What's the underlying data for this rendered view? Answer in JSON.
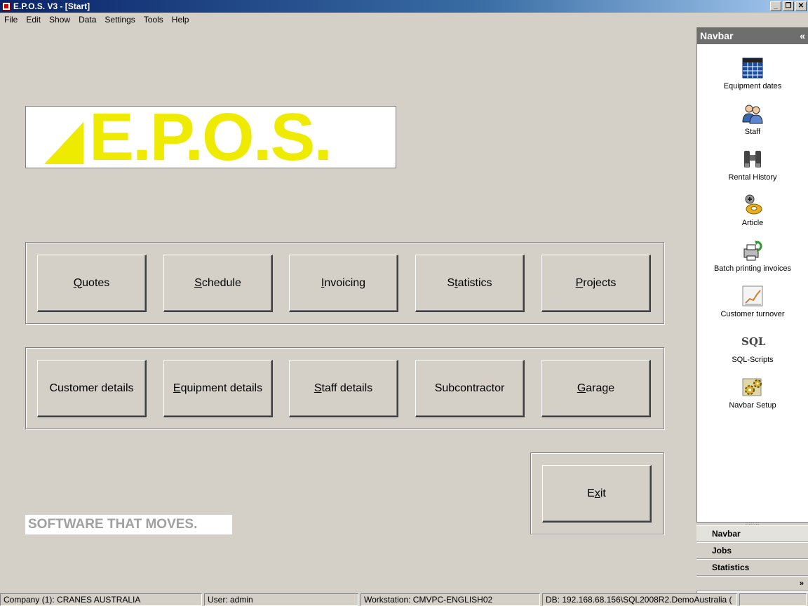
{
  "window": {
    "title": "E.P.O.S. V3 - [Start]",
    "minimize": "_",
    "restore": "❐",
    "close": "✕"
  },
  "menu": [
    "File",
    "Edit",
    "Show",
    "Data",
    "Settings",
    "Tools",
    "Help"
  ],
  "logo": {
    "text": "E.P.O.S.",
    "color": "#eeea00"
  },
  "buttons_row1": [
    {
      "pre": "",
      "u": "Q",
      "post": "uotes"
    },
    {
      "pre": "",
      "u": "S",
      "post": "chedule"
    },
    {
      "pre": "",
      "u": "I",
      "post": "nvoicing"
    },
    {
      "pre": "S",
      "u": "t",
      "post": "atistics"
    },
    {
      "pre": "",
      "u": "P",
      "post": "rojects"
    }
  ],
  "buttons_row2": [
    {
      "pre": "Customer details",
      "u": "",
      "post": ""
    },
    {
      "pre": "",
      "u": "E",
      "post": "quipment details"
    },
    {
      "pre": "",
      "u": "S",
      "post": "taff details"
    },
    {
      "pre": "Subcontractor",
      "u": "",
      "post": ""
    },
    {
      "pre": "",
      "u": "G",
      "post": "arage"
    }
  ],
  "exit_button": {
    "pre": "E",
    "u": "x",
    "post": "it"
  },
  "tagline": "SOFTWARE THAT MOVES.",
  "navbar": {
    "title": "Navbar",
    "collapse_glyph": "«",
    "items": [
      {
        "label": "Equipment dates",
        "icon": "calendar-icon"
      },
      {
        "label": "Staff",
        "icon": "staff-icon"
      },
      {
        "label": "Rental History",
        "icon": "binoculars-icon"
      },
      {
        "label": "Article",
        "icon": "article-icon"
      },
      {
        "label": "Batch printing invoices",
        "icon": "printer-icon"
      },
      {
        "label": "Customer turnover",
        "icon": "chart-icon"
      },
      {
        "label": "SQL-Scripts",
        "icon": "sql-icon"
      },
      {
        "label": "Navbar Setup",
        "icon": "gears-icon"
      }
    ],
    "sql_icon_text": "SQL",
    "groups": [
      "Navbar",
      "Jobs",
      "Statistics"
    ],
    "more_glyph": "»"
  },
  "status": {
    "company": "Company (1): CRANES AUSTRALIA",
    "user": "User: admin",
    "workstation": "Workstation: CMVPC-ENGLISH02",
    "db": "DB: 192.168.68.156\\SQL2008R2.DemoAustralia ("
  }
}
